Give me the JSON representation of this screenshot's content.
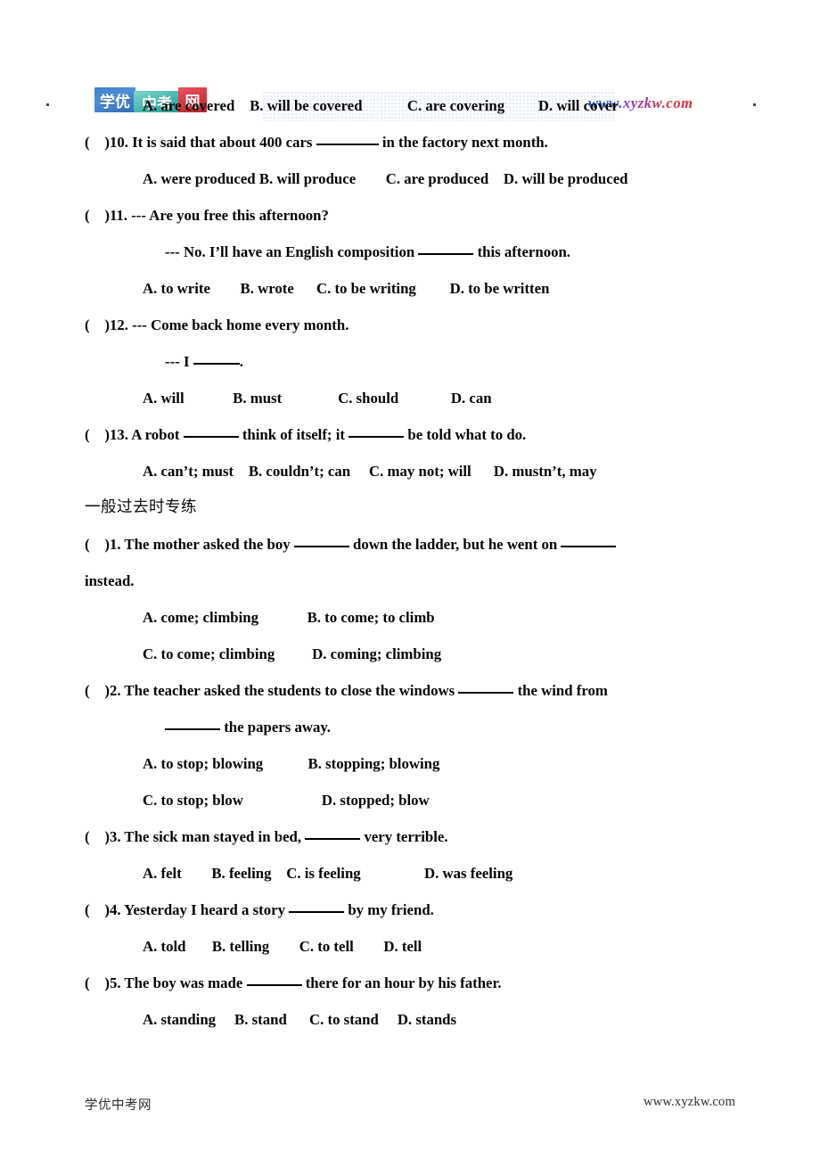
{
  "header": {
    "logo": {
      "segment_1": "学优",
      "segment_2": "中考",
      "segment_3": "网",
      "colors": {
        "segment_1": "#3f7fd0",
        "segment_2": "#49b6ae",
        "segment_3": "#d2333f"
      }
    },
    "url": "www.xyzkw.com",
    "url_colors": [
      "#2b5fc4",
      "#4a56c0",
      "#7a46b4",
      "#a93c92",
      "#c93560",
      "#d8333f"
    ],
    "dot_left": "·",
    "dot_right": "·"
  },
  "footer": {
    "left": "学优中考网",
    "right": "www.xyzkw.com"
  },
  "lines": [
    {
      "id": "q9-options",
      "kind": "options",
      "text": "A. are covered    B. will be covered            C. are covering         D. will cover"
    },
    {
      "id": "q10-stem-a",
      "kind": "stem",
      "prefix": "(    )10. It is said that about 400 cars ",
      "suffix": " in the factory next month."
    },
    {
      "id": "q10-options",
      "kind": "options",
      "text": "A. were produced B. will produce        C. are produced    D. will be produced"
    },
    {
      "id": "q11-stem-a",
      "kind": "stem-plain",
      "text": "(    )11. --- Are you free this afternoon?"
    },
    {
      "id": "q11-stem-b",
      "kind": "cont",
      "prefix": "--- No. I’ll have an English composition ",
      "suffix": " this afternoon."
    },
    {
      "id": "q11-options",
      "kind": "options",
      "text": "A. to write        B. wrote      C. to be writing         D. to be written"
    },
    {
      "id": "q12-stem-a",
      "kind": "stem-plain",
      "text": "(    )12. --- Come back home every month."
    },
    {
      "id": "q12-stem-b",
      "kind": "cont",
      "prefix": "--- I ",
      "suffix": "."
    },
    {
      "id": "q12-options",
      "kind": "options",
      "text": "A. will             B. must               C. should              D. can"
    },
    {
      "id": "q13-stem",
      "kind": "stem-double",
      "prefix": "(    )13. A robot ",
      "middle": " think of itself; it ",
      "suffix": " be told what to do."
    },
    {
      "id": "q13-options",
      "kind": "options",
      "text": "A. can’t; must    B. couldn’t; can     C. may not; will      D. mustn’t, may"
    },
    {
      "id": "section-heading",
      "kind": "cn-heading",
      "text": "一般过去时专练"
    },
    {
      "id": "p1-stem-a",
      "kind": "stem-double-tail",
      "prefix": "(    )1. The mother asked the boy ",
      "middle": " down the ladder, but he went on ",
      "suffix": ""
    },
    {
      "id": "p1-stem-b",
      "kind": "stem-plain-flush",
      "text": "instead."
    },
    {
      "id": "p1-options-ab",
      "kind": "options",
      "text": "A. come; climbing             B. to come; to climb"
    },
    {
      "id": "p1-options-cd",
      "kind": "options",
      "text": "C. to come; climbing          D. coming; climbing"
    },
    {
      "id": "p2-stem-a",
      "kind": "stem",
      "prefix": "(    )2. The teacher asked the students to close the windows ",
      "suffix": " the wind from"
    },
    {
      "id": "p2-stem-b",
      "kind": "cont-blank-first",
      "prefix": "",
      "suffix": " the papers away."
    },
    {
      "id": "p2-options-ab",
      "kind": "options",
      "text": "A. to stop; blowing            B. stopping; blowing"
    },
    {
      "id": "p2-options-cd",
      "kind": "options",
      "text": "C. to stop; blow                     D. stopped; blow"
    },
    {
      "id": "p3-stem",
      "kind": "stem",
      "prefix": "(    )3. The sick man stayed in bed, ",
      "suffix": " very terrible."
    },
    {
      "id": "p3-options",
      "kind": "options",
      "text": "A. felt        B. feeling    C. is feeling                 D. was feeling"
    },
    {
      "id": "p4-stem",
      "kind": "stem",
      "prefix": "(    )4. Yesterday I heard a story ",
      "suffix": " by my friend."
    },
    {
      "id": "p4-options",
      "kind": "options",
      "text": "A. told       B. telling        C. to tell        D. tell"
    },
    {
      "id": "p5-stem",
      "kind": "stem",
      "prefix": "(    )5. The boy was made ",
      "suffix": " there for an hour by his father."
    },
    {
      "id": "p5-options",
      "kind": "options",
      "text": "A. standing     B. stand      C. to stand     D. stands"
    }
  ]
}
